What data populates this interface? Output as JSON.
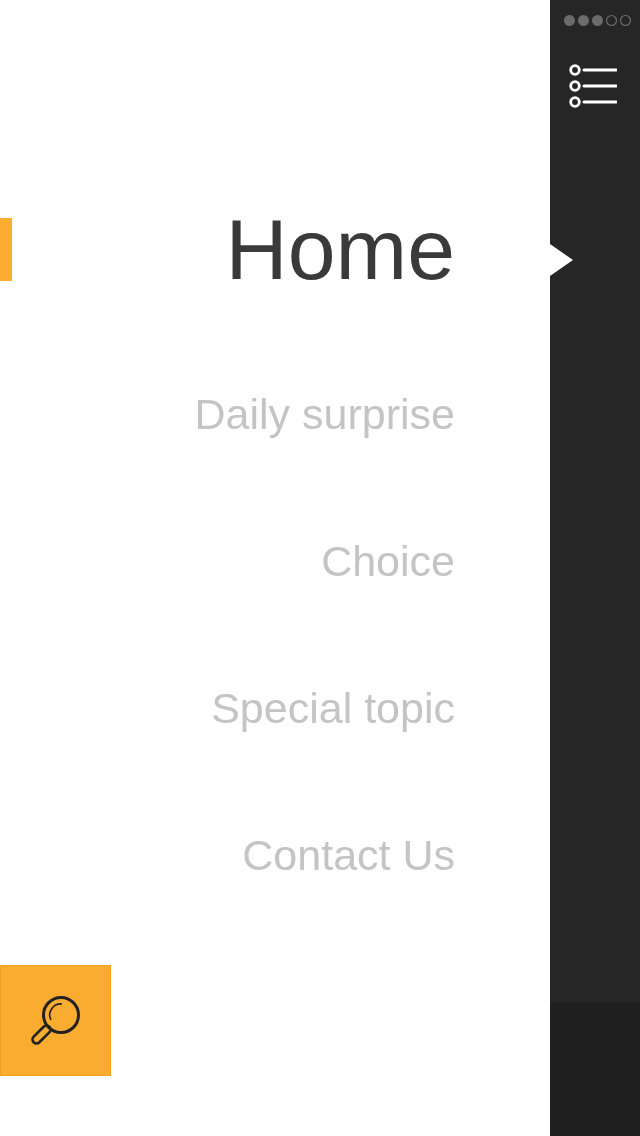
{
  "menu": [
    {
      "label": "Home",
      "selected": true
    },
    {
      "label": "Daily surprise",
      "selected": false
    },
    {
      "label": "Choice",
      "selected": false
    },
    {
      "label": "Special topic",
      "selected": false
    },
    {
      "label": "Contact Us",
      "selected": false
    }
  ]
}
